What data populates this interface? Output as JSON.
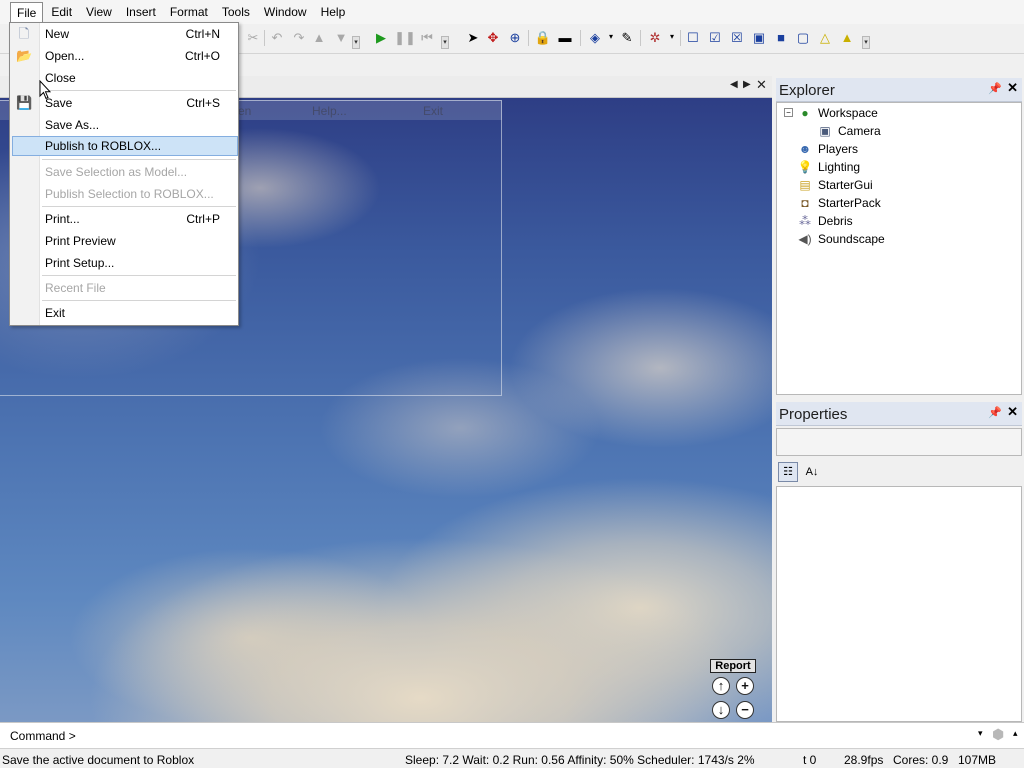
{
  "menubar": {
    "items": [
      "File",
      "Edit",
      "View",
      "Insert",
      "Format",
      "Tools",
      "Window",
      "Help"
    ]
  },
  "file_menu": {
    "items": [
      {
        "label": "New",
        "shortcut": "Ctrl+N",
        "icon": "new-file-icon"
      },
      {
        "label": "Open...",
        "shortcut": "Ctrl+O",
        "icon": "open-folder-icon"
      },
      {
        "label": "Close",
        "shortcut": ""
      },
      {
        "label": "Save",
        "shortcut": "Ctrl+S",
        "icon": "floppy-disk-icon"
      },
      {
        "label": "Save As...",
        "shortcut": ""
      },
      {
        "label": "Publish to ROBLOX...",
        "shortcut": "",
        "highlighted": true
      },
      {
        "label": "Save Selection as Model...",
        "shortcut": "",
        "disabled": true
      },
      {
        "label": "Publish Selection to ROBLOX...",
        "shortcut": "",
        "disabled": true
      },
      {
        "label": "Print...",
        "shortcut": "Ctrl+P"
      },
      {
        "label": "Print Preview",
        "shortcut": ""
      },
      {
        "label": "Print Setup...",
        "shortcut": ""
      },
      {
        "label": "Recent File",
        "shortcut": "",
        "disabled": true
      },
      {
        "label": "Exit",
        "shortcut": ""
      }
    ]
  },
  "game_menu": {
    "fullscreen": "Fullscreen",
    "help": "Help...",
    "exit": "Exit"
  },
  "viewport": {
    "report": "Report"
  },
  "explorer": {
    "title": "Explorer",
    "items": [
      {
        "label": "Workspace",
        "icon": "globe-icon"
      },
      {
        "label": "Camera",
        "icon": "camera-icon"
      },
      {
        "label": "Players",
        "icon": "players-icon"
      },
      {
        "label": "Lighting",
        "icon": "lightbulb-icon"
      },
      {
        "label": "StarterGui",
        "icon": "gui-icon"
      },
      {
        "label": "StarterPack",
        "icon": "backpack-icon"
      },
      {
        "label": "Debris",
        "icon": "debris-icon"
      },
      {
        "label": "Soundscape",
        "icon": "speaker-icon"
      }
    ]
  },
  "properties": {
    "title": "Properties"
  },
  "command": {
    "label": "Command >",
    "value": ""
  },
  "status": {
    "message": "Save the active document to Roblox",
    "stats": "Sleep: 7.2 Wait: 0.2 Run: 0.56 Affinity: 50% Scheduler: 1743/s 2%",
    "t": "t 0",
    "fps": "28.9fps",
    "cores": "Cores: 0.9",
    "memory": "107MB"
  },
  "colors": {
    "menu_highlight": "#cde3f7",
    "panel_title_bg": "#e0e6f1",
    "play_green": "#1e9a1e",
    "toolbar_blue": "#1a3f9e"
  }
}
